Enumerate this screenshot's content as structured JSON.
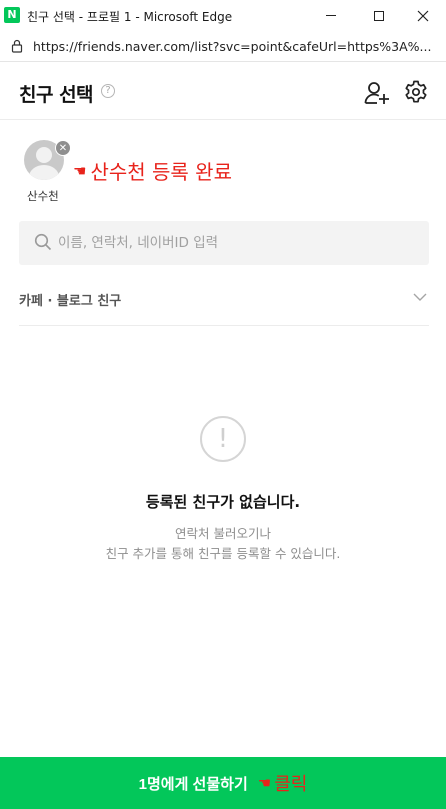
{
  "window": {
    "app_icon_letter": "N",
    "title": "친구 선택 - 프로필 1 - Microsoft Edge"
  },
  "address_bar": {
    "url": "https://friends.naver.com/list?svc=point&cafeUrl=https%3A%..."
  },
  "header": {
    "title": "친구 선택",
    "help_glyph": "?"
  },
  "selected": [
    {
      "name": "산수천",
      "remove_glyph": "✕"
    }
  ],
  "annotation_registered": {
    "hand": "☚",
    "text": "산수천 등록 완료"
  },
  "search": {
    "placeholder": "이름, 연락처, 네이버ID 입력",
    "value": ""
  },
  "category": {
    "label": "카페 · 블로그 친구"
  },
  "empty_state": {
    "glyph": "!",
    "title": "등록된 친구가 없습니다.",
    "line1": "연락처 불러오기나",
    "line2": "친구 추가를 통해 친구를 등록할 수 있습니다."
  },
  "bottom_button": {
    "label": "1명에게 선물하기",
    "annotation_hand": "☚",
    "annotation_text": "클릭"
  },
  "colors": {
    "brand_green": "#03c75a",
    "annotation_red": "#e8231b"
  }
}
